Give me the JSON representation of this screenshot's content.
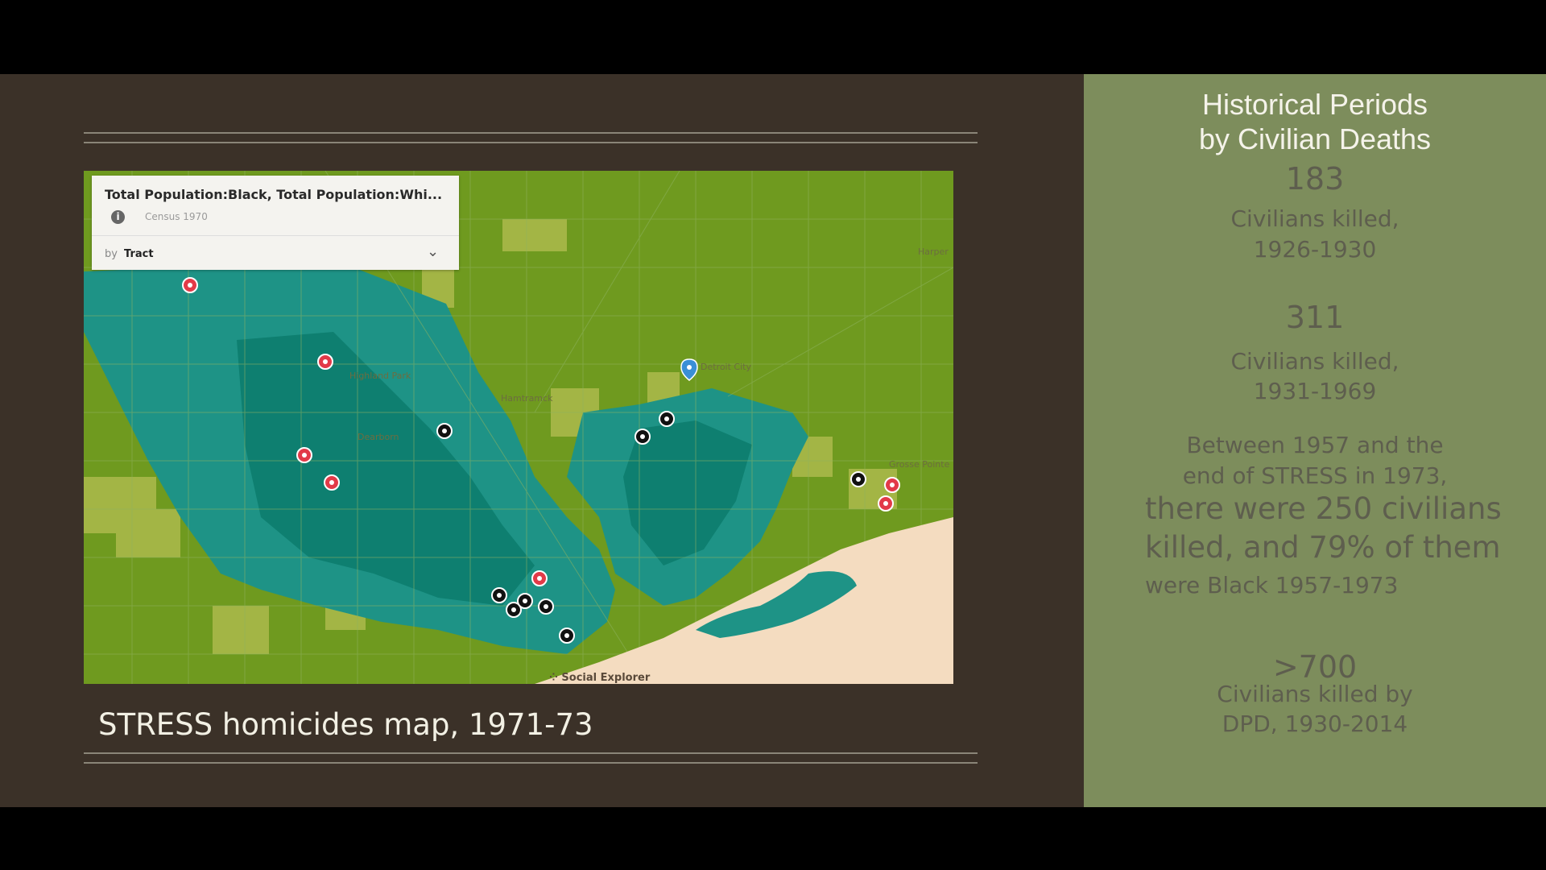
{
  "map": {
    "legend_title": "Total Population:Black, Total Population:Whi...",
    "legend_source": "Census 1970",
    "legend_by": "by",
    "legend_geography": "Tract",
    "attribution": "Social Explorer",
    "colors": {
      "green": "#6f9a1f",
      "light_green": "#a3b545",
      "teal": "#1e9386",
      "dark_teal": "#0e7f70",
      "water": "#f4dcc0",
      "marker_red": "#e23a48",
      "marker_black": "#111111"
    },
    "place_labels": [
      "Highland Park",
      "Hamtramck",
      "Detroit City",
      "Dearborn",
      "Grosse Pointe",
      "Harper"
    ]
  },
  "caption": "STRESS homicides map, 1971-73",
  "sidebar": {
    "title_line1": "Historical Periods",
    "title_line2": "by Civilian Deaths",
    "stat1_value": "183",
    "stat1_label1": "Civilians killed,",
    "stat1_label2": "1926-1930",
    "stat2_value": "311",
    "stat2_label1": "Civilians killed,",
    "stat2_label2": "1931-1969",
    "stat3_line1": "Between 1957 and the",
    "stat3_line2": "end of STRESS in 1973,",
    "stat3_line3": "there were 250 civilians",
    "stat3_line4": "killed, and 79% of them",
    "stat3_line5": "were Black 1957-1973",
    "stat4_value": ">700",
    "stat4_label1": "Civilians killed by",
    "stat4_label2": "DPD, 1930-2014"
  }
}
